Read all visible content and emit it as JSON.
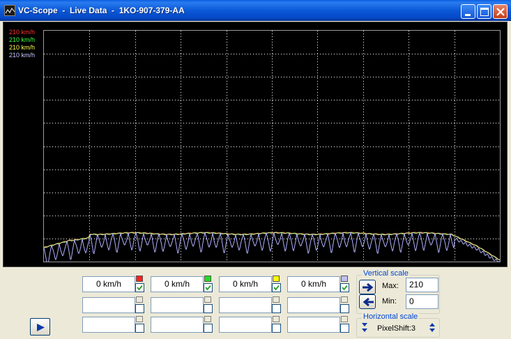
{
  "window": {
    "title": "VC-Scope  -  Live Data  -  1KO-907-379-AA"
  },
  "legend": [
    {
      "text": "210 km/h",
      "color": "#ff3030"
    },
    {
      "text": "210 km/h",
      "color": "#40ff40"
    },
    {
      "text": "210 km/h",
      "color": "#ffff50"
    },
    {
      "text": "210 km/h",
      "color": "#c8c8ff"
    }
  ],
  "channels": [
    {
      "value": "0 km/h",
      "color": "#ff2020",
      "checked": true
    },
    {
      "value": "0 km/h",
      "color": "#20e020",
      "checked": true
    },
    {
      "value": "0 km/h",
      "color": "#ffff00",
      "checked": true
    },
    {
      "value": "0 km/h",
      "color": "#c0c0f0",
      "checked": true
    }
  ],
  "vertical_scale": {
    "label": "Vertical scale",
    "max_label": "Max:",
    "max_value": "210",
    "min_label": "Min:",
    "min_value": "0"
  },
  "horizontal_scale": {
    "label": "Horizontal scale",
    "value": "PixelShift:3"
  },
  "colors": {
    "plot_bg": "#000000",
    "grid": "#ffffff",
    "trace_main": "#e8e8b0",
    "trace_wave": "#b0b0ff"
  }
}
